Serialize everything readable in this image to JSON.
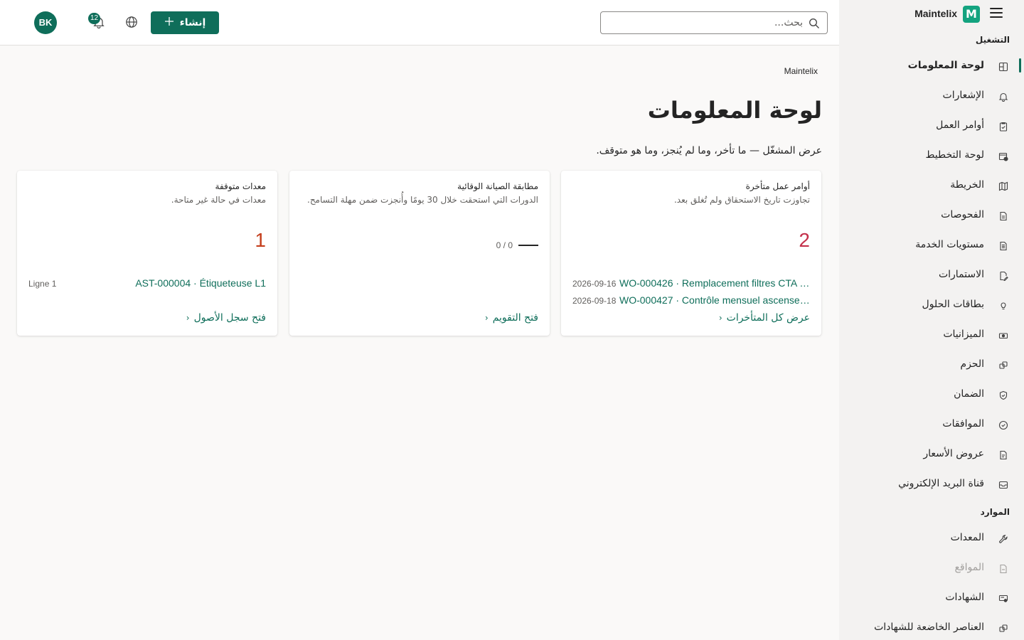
{
  "app": {
    "name": "Maintelix",
    "logo_letter": "M"
  },
  "header": {
    "search_placeholder": "بحث...",
    "create_label": "إنشاء",
    "notifications_count": "12",
    "avatar_initials": "BK"
  },
  "sidebar": {
    "section_operations": "التشغيل",
    "section_resources": "الموارد",
    "operations": [
      {
        "label": "لوحة المعلومات",
        "icon": "dashboard-icon",
        "active": true
      },
      {
        "label": "الإشعارات",
        "icon": "bell-icon"
      },
      {
        "label": "أوامر العمل",
        "icon": "clipboard-check-icon"
      },
      {
        "label": "لوحة التخطيط",
        "icon": "calendar-clock-icon"
      },
      {
        "label": "الخريطة",
        "icon": "map-icon"
      },
      {
        "label": "الفحوصات",
        "icon": "document-icon"
      },
      {
        "label": "مستويات الخدمة",
        "icon": "document-list-icon"
      },
      {
        "label": "الاستمارات",
        "icon": "form-edit-icon"
      },
      {
        "label": "بطاقات الحلول",
        "icon": "lightbulb-icon"
      },
      {
        "label": "الميزانيات",
        "icon": "money-icon"
      },
      {
        "label": "الحزم",
        "icon": "packages-icon"
      },
      {
        "label": "الضمان",
        "icon": "shield-check-icon"
      },
      {
        "label": "الموافقات",
        "icon": "check-circle-icon"
      },
      {
        "label": "عروض الأسعار",
        "icon": "quote-document-icon"
      },
      {
        "label": "قناة البريد الإلكتروني",
        "icon": "mail-icon"
      }
    ],
    "resources": [
      {
        "label": "المعدات",
        "icon": "wrench-icon"
      },
      {
        "label": "المواقع",
        "icon": "location-document-icon",
        "disabled": true
      },
      {
        "label": "الشهادات",
        "icon": "certificate-icon"
      },
      {
        "label": "العناصر الخاضعة للشهادات",
        "icon": "certified-items-icon"
      }
    ]
  },
  "main": {
    "breadcrumb": "Maintelix",
    "title": "لوحة المعلومات",
    "subtitle": "عرض المشغّل — ما تأخر، وما لم يُنجز، وما هو متوقف.",
    "cards": {
      "overdue": {
        "title": "أوامر عمل متأخرة",
        "description": "تجاوزت تاريخ الاستحقاق ولم تُغلق بعد.",
        "count": "2",
        "items": [
          {
            "label": "WO-000426 · Remplacement filtres CTA É...",
            "date": "2026-09-16"
          },
          {
            "label": "WO-000427 · Contrôle mensuel ascenseu...",
            "date": "2026-09-18"
          }
        ],
        "link": "عرض كل المتأخرات"
      },
      "pm": {
        "title": "مطابقة الصيانة الوقائية",
        "description": "الدورات التي استحقت خلال 30 يومًا وأُنجزت ضمن مهلة التسامح.",
        "ratio": "0 / 0",
        "link": "فتح التقويم"
      },
      "down": {
        "title": "معدات متوقفة",
        "description": "معدات في حالة غير متاحة.",
        "count": "1",
        "items": [
          {
            "label": "AST-000004 · Étiqueteuse L1",
            "location": "Ligne 1"
          }
        ],
        "link": "فتح سجل الأصول"
      }
    }
  },
  "colors": {
    "accent": "#0f6e5a",
    "brand_logo": "#13a37f",
    "danger": "#c4314b",
    "warning": "#c43e1c"
  }
}
